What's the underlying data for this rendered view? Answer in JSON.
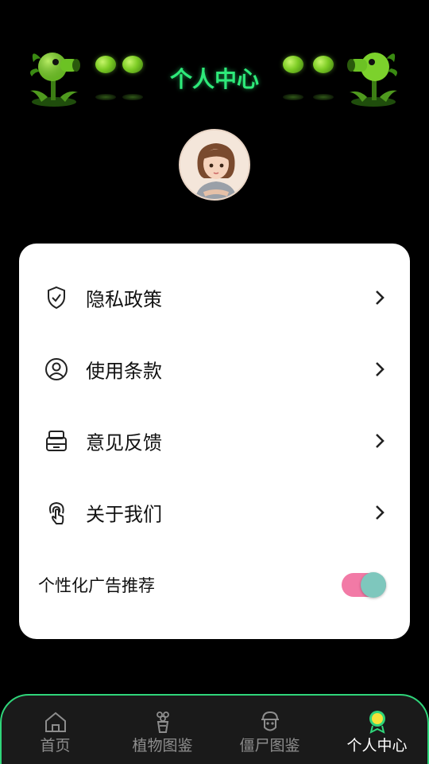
{
  "header": {
    "title": "个人中心",
    "decoration_left_icon": "peashooter-icon",
    "decoration_right_icon": "peashooter-icon"
  },
  "profile": {
    "avatar_icon": "avatar-girl-icon"
  },
  "menu": {
    "items": [
      {
        "label": "隐私政策",
        "icon": "shield-check-icon"
      },
      {
        "label": "使用条款",
        "icon": "user-circle-icon"
      },
      {
        "label": "意见反馈",
        "icon": "feedback-box-icon"
      },
      {
        "label": "关于我们",
        "icon": "touch-hand-icon"
      }
    ],
    "ad_toggle": {
      "label": "个性化广告推荐",
      "on": true
    }
  },
  "tabbar": {
    "tabs": [
      {
        "label": "首页",
        "icon": "home-icon",
        "active": false
      },
      {
        "label": "植物图鉴",
        "icon": "plant-pot-icon",
        "active": false
      },
      {
        "label": "僵尸图鉴",
        "icon": "zombie-head-icon",
        "active": false
      },
      {
        "label": "个人中心",
        "icon": "sunflower-icon",
        "active": true
      }
    ]
  },
  "colors": {
    "accent_green": "#2eea7a",
    "toggle_track": "#f27aa6",
    "toggle_knob": "#7ec7bd",
    "tabbar_border": "#2fd57a"
  }
}
